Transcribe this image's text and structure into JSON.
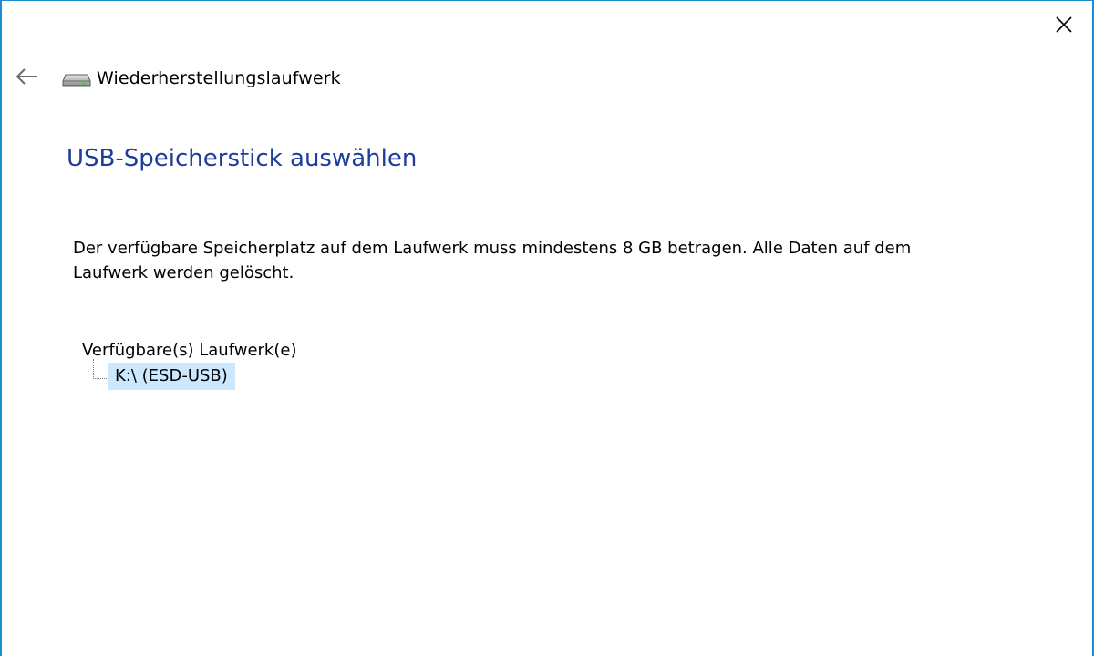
{
  "window": {
    "title": "Wiederherstellungslaufwerk",
    "border_color": "#1f8ad2"
  },
  "icons": {
    "close": "close-icon",
    "back": "back-arrow-icon",
    "app": "drive-icon"
  },
  "page": {
    "heading": "USB-Speicherstick auswählen",
    "description": "Der verfügbare Speicherplatz auf dem Laufwerk muss mindestens 8 GB betragen. Alle Daten auf dem Laufwerk werden gelöscht.",
    "heading_color": "#1e3c9c"
  },
  "drives": {
    "root_label": "Verfügbare(s) Laufwerk(e)",
    "items": [
      {
        "label": "K:\\ (ESD-USB)",
        "selected": true
      }
    ],
    "selection_color": "#cce8ff"
  }
}
